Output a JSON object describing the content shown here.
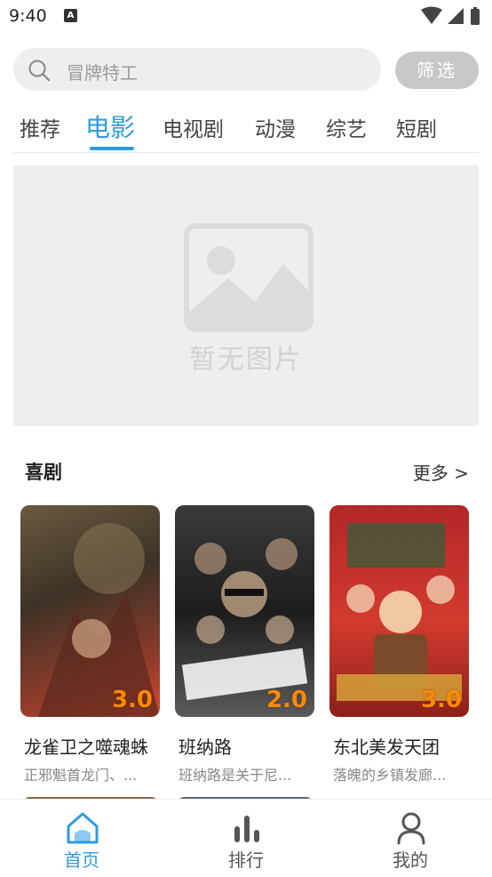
{
  "status_bar": {
    "time": "9:40",
    "notification_badge": "A"
  },
  "search": {
    "placeholder": "冒牌特工",
    "filter_label": "筛选"
  },
  "tabs": [
    {
      "label": "推荐",
      "active": false
    },
    {
      "label": "电影",
      "active": true
    },
    {
      "label": "电视剧",
      "active": false
    },
    {
      "label": "动漫",
      "active": false
    },
    {
      "label": "综艺",
      "active": false
    },
    {
      "label": "短剧",
      "active": false
    }
  ],
  "banner": {
    "placeholder_text": "暂无图片",
    "icon": "image-placeholder-icon"
  },
  "section": {
    "title": "喜剧",
    "more_label": "更多 >"
  },
  "movies": [
    {
      "title": "龙雀卫之噬魂蛛",
      "description": "正邪魁首龙门、...",
      "rating": "3.0"
    },
    {
      "title": "班纳路",
      "description": "班纳路是关于尼...",
      "rating": "2.0"
    },
    {
      "title": "东北美发天团",
      "description": "落魄的乡镇发廊...",
      "rating": "3.0"
    }
  ],
  "bottom_nav": [
    {
      "label": "首页",
      "icon": "home-icon",
      "active": true
    },
    {
      "label": "排行",
      "icon": "bar-chart-icon",
      "active": false
    },
    {
      "label": "我的",
      "icon": "user-icon",
      "active": false
    }
  ],
  "colors": {
    "accent": "#2c9ce0",
    "rating": "#ff8a00",
    "filter_bg": "#c8c8c8"
  }
}
